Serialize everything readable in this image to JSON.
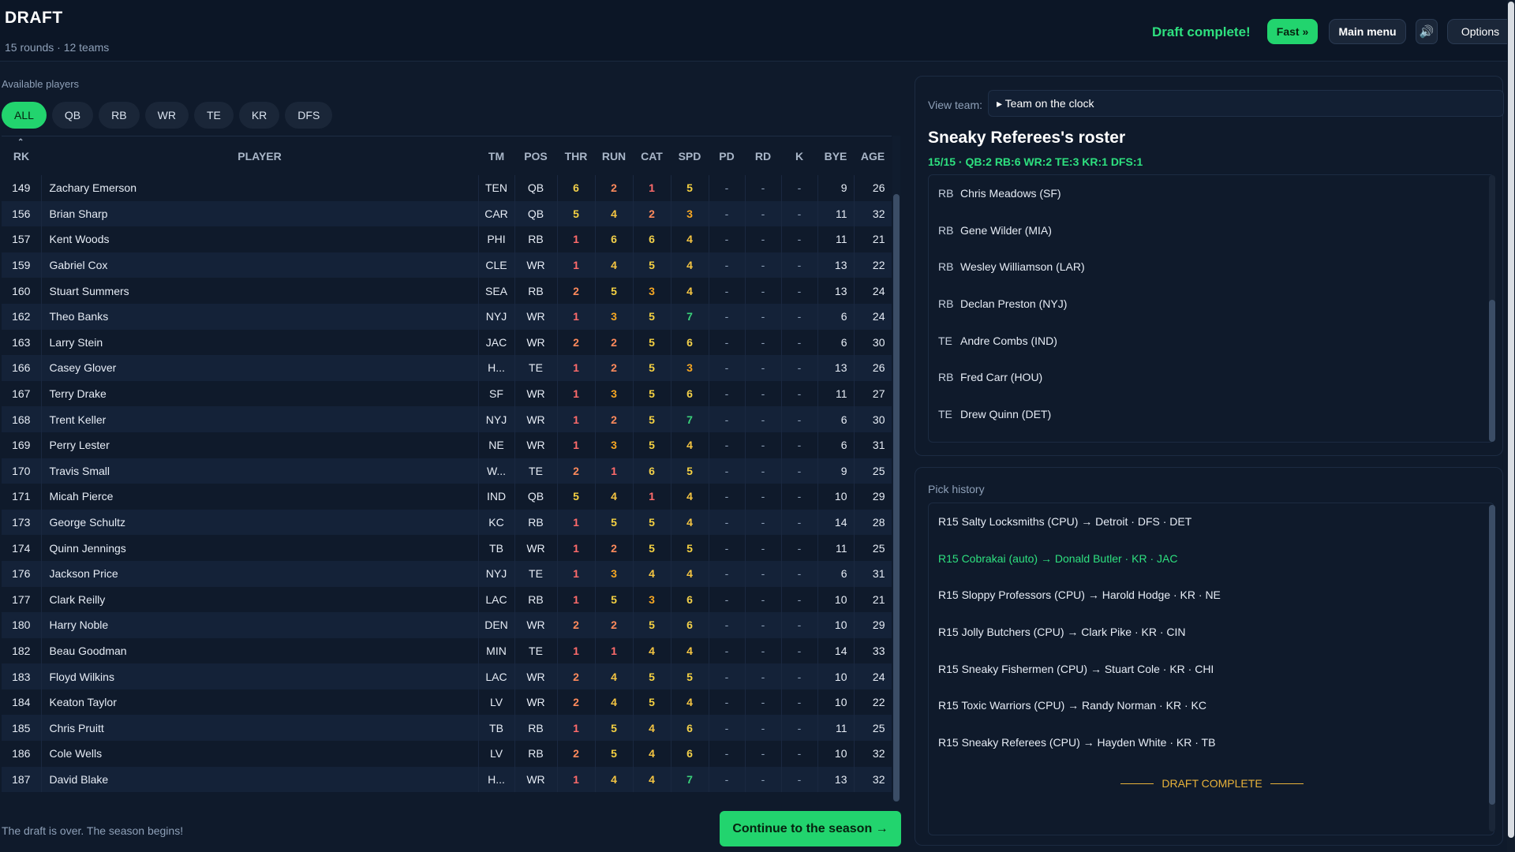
{
  "header": {
    "title": "DRAFT",
    "subtitle": "15 rounds · 12 teams",
    "status": "Draft complete!",
    "fast_label": "Fast »",
    "main_menu_label": "Main menu",
    "sound_icon": "🔊",
    "options_label": "Options"
  },
  "players": {
    "label": "Available players",
    "filters": [
      "ALL",
      "QB",
      "RB",
      "WR",
      "TE",
      "KR",
      "DFS"
    ],
    "active_filter": "ALL",
    "sort_caret": "⌃",
    "columns": [
      "RK",
      "PLAYER",
      "TM",
      "POS",
      "THR",
      "RUN",
      "CAT",
      "SPD",
      "PD",
      "RD",
      "K",
      "BYE",
      "AGE"
    ],
    "rows": [
      {
        "rk": "149",
        "name": "Zachary Emerson",
        "tm": "TEN",
        "pos": "QB",
        "thr": "6",
        "run": "2",
        "cat": "1",
        "spd": "5",
        "pd": "-",
        "rd": "-",
        "k": "-",
        "bye": "9",
        "age": "26"
      },
      {
        "rk": "156",
        "name": "Brian Sharp",
        "tm": "CAR",
        "pos": "QB",
        "thr": "5",
        "run": "4",
        "cat": "2",
        "spd": "3",
        "pd": "-",
        "rd": "-",
        "k": "-",
        "bye": "11",
        "age": "32"
      },
      {
        "rk": "157",
        "name": "Kent Woods",
        "tm": "PHI",
        "pos": "RB",
        "thr": "1",
        "run": "6",
        "cat": "6",
        "spd": "4",
        "pd": "-",
        "rd": "-",
        "k": "-",
        "bye": "11",
        "age": "21"
      },
      {
        "rk": "159",
        "name": "Gabriel Cox",
        "tm": "CLE",
        "pos": "WR",
        "thr": "1",
        "run": "4",
        "cat": "5",
        "spd": "4",
        "pd": "-",
        "rd": "-",
        "k": "-",
        "bye": "13",
        "age": "22"
      },
      {
        "rk": "160",
        "name": "Stuart Summers",
        "tm": "SEA",
        "pos": "RB",
        "thr": "2",
        "run": "5",
        "cat": "3",
        "spd": "4",
        "pd": "-",
        "rd": "-",
        "k": "-",
        "bye": "13",
        "age": "24"
      },
      {
        "rk": "162",
        "name": "Theo Banks",
        "tm": "NYJ",
        "pos": "WR",
        "thr": "1",
        "run": "3",
        "cat": "5",
        "spd": "7",
        "pd": "-",
        "rd": "-",
        "k": "-",
        "bye": "6",
        "age": "24"
      },
      {
        "rk": "163",
        "name": "Larry Stein",
        "tm": "JAC",
        "pos": "WR",
        "thr": "2",
        "run": "2",
        "cat": "5",
        "spd": "6",
        "pd": "-",
        "rd": "-",
        "k": "-",
        "bye": "6",
        "age": "30"
      },
      {
        "rk": "166",
        "name": "Casey Glover",
        "tm": "H...",
        "pos": "TE",
        "thr": "1",
        "run": "2",
        "cat": "5",
        "spd": "3",
        "pd": "-",
        "rd": "-",
        "k": "-",
        "bye": "13",
        "age": "26"
      },
      {
        "rk": "167",
        "name": "Terry Drake",
        "tm": "SF",
        "pos": "WR",
        "thr": "1",
        "run": "3",
        "cat": "5",
        "spd": "6",
        "pd": "-",
        "rd": "-",
        "k": "-",
        "bye": "11",
        "age": "27"
      },
      {
        "rk": "168",
        "name": "Trent Keller",
        "tm": "NYJ",
        "pos": "WR",
        "thr": "1",
        "run": "2",
        "cat": "5",
        "spd": "7",
        "pd": "-",
        "rd": "-",
        "k": "-",
        "bye": "6",
        "age": "30"
      },
      {
        "rk": "169",
        "name": "Perry Lester",
        "tm": "NE",
        "pos": "WR",
        "thr": "1",
        "run": "3",
        "cat": "5",
        "spd": "4",
        "pd": "-",
        "rd": "-",
        "k": "-",
        "bye": "6",
        "age": "31"
      },
      {
        "rk": "170",
        "name": "Travis Small",
        "tm": "W...",
        "pos": "TE",
        "thr": "2",
        "run": "1",
        "cat": "6",
        "spd": "5",
        "pd": "-",
        "rd": "-",
        "k": "-",
        "bye": "9",
        "age": "25"
      },
      {
        "rk": "171",
        "name": "Micah Pierce",
        "tm": "IND",
        "pos": "QB",
        "thr": "5",
        "run": "4",
        "cat": "1",
        "spd": "4",
        "pd": "-",
        "rd": "-",
        "k": "-",
        "bye": "10",
        "age": "29"
      },
      {
        "rk": "173",
        "name": "George Schultz",
        "tm": "KC",
        "pos": "RB",
        "thr": "1",
        "run": "5",
        "cat": "5",
        "spd": "4",
        "pd": "-",
        "rd": "-",
        "k": "-",
        "bye": "14",
        "age": "28"
      },
      {
        "rk": "174",
        "name": "Quinn Jennings",
        "tm": "TB",
        "pos": "WR",
        "thr": "1",
        "run": "2",
        "cat": "5",
        "spd": "5",
        "pd": "-",
        "rd": "-",
        "k": "-",
        "bye": "11",
        "age": "25"
      },
      {
        "rk": "176",
        "name": "Jackson Price",
        "tm": "NYJ",
        "pos": "TE",
        "thr": "1",
        "run": "3",
        "cat": "4",
        "spd": "4",
        "pd": "-",
        "rd": "-",
        "k": "-",
        "bye": "6",
        "age": "31"
      },
      {
        "rk": "177",
        "name": "Clark Reilly",
        "tm": "LAC",
        "pos": "RB",
        "thr": "1",
        "run": "5",
        "cat": "3",
        "spd": "6",
        "pd": "-",
        "rd": "-",
        "k": "-",
        "bye": "10",
        "age": "21"
      },
      {
        "rk": "180",
        "name": "Harry Noble",
        "tm": "DEN",
        "pos": "WR",
        "thr": "2",
        "run": "2",
        "cat": "5",
        "spd": "6",
        "pd": "-",
        "rd": "-",
        "k": "-",
        "bye": "10",
        "age": "29"
      },
      {
        "rk": "182",
        "name": "Beau Goodman",
        "tm": "MIN",
        "pos": "TE",
        "thr": "1",
        "run": "1",
        "cat": "4",
        "spd": "4",
        "pd": "-",
        "rd": "-",
        "k": "-",
        "bye": "14",
        "age": "33"
      },
      {
        "rk": "183",
        "name": "Floyd Wilkins",
        "tm": "LAC",
        "pos": "WR",
        "thr": "2",
        "run": "4",
        "cat": "5",
        "spd": "5",
        "pd": "-",
        "rd": "-",
        "k": "-",
        "bye": "10",
        "age": "24"
      },
      {
        "rk": "184",
        "name": "Keaton Taylor",
        "tm": "LV",
        "pos": "WR",
        "thr": "2",
        "run": "4",
        "cat": "5",
        "spd": "4",
        "pd": "-",
        "rd": "-",
        "k": "-",
        "bye": "10",
        "age": "22"
      },
      {
        "rk": "185",
        "name": "Chris Pruitt",
        "tm": "TB",
        "pos": "RB",
        "thr": "1",
        "run": "5",
        "cat": "4",
        "spd": "6",
        "pd": "-",
        "rd": "-",
        "k": "-",
        "bye": "11",
        "age": "25"
      },
      {
        "rk": "186",
        "name": "Cole Wells",
        "tm": "LV",
        "pos": "RB",
        "thr": "2",
        "run": "5",
        "cat": "4",
        "spd": "6",
        "pd": "-",
        "rd": "-",
        "k": "-",
        "bye": "10",
        "age": "32"
      },
      {
        "rk": "187",
        "name": "David Blake",
        "tm": "H...",
        "pos": "WR",
        "thr": "1",
        "run": "4",
        "cat": "4",
        "spd": "7",
        "pd": "-",
        "rd": "-",
        "k": "-",
        "bye": "13",
        "age": "32"
      }
    ]
  },
  "stat_colors": {
    "1": "#ff6b6b",
    "2": "#ff8a5c",
    "3": "#f5a623",
    "4": "#f5c542",
    "5": "#f5d142",
    "6": "#f2d04a",
    "7": "#3ad17a"
  },
  "footer": {
    "message": "The draft is over. The season begins!",
    "continue_label": "Continue to the season →"
  },
  "roster": {
    "view_label": "View team:",
    "view_value": "▸ Team on the clock",
    "title": "Sneaky Referees's roster",
    "summary": "15/15  ·  QB:2 RB:6 WR:2 TE:3 KR:1 DFS:1",
    "items": [
      {
        "pos": "RB",
        "text": "Chris Meadows  (SF)"
      },
      {
        "pos": "RB",
        "text": "Gene Wilder  (MIA)"
      },
      {
        "pos": "RB",
        "text": "Wesley Williamson  (LAR)"
      },
      {
        "pos": "RB",
        "text": "Declan Preston  (NYJ)"
      },
      {
        "pos": "TE",
        "text": "Andre Combs  (IND)"
      },
      {
        "pos": "RB",
        "text": "Fred Carr  (HOU)"
      },
      {
        "pos": "TE",
        "text": "Drew Quinn  (DET)"
      }
    ]
  },
  "history": {
    "label": "Pick history",
    "items": [
      {
        "text": "R15  Salty Locksmiths (CPU)  →  Detroit · DFS · DET",
        "highlight": false
      },
      {
        "text": "R15  Cobrakai (auto)  →  Donald Butler · KR · JAC",
        "highlight": true
      },
      {
        "text": "R15  Sloppy Professors (CPU)  →  Harold Hodge · KR · NE",
        "highlight": false
      },
      {
        "text": "R15  Jolly Butchers (CPU)  →  Clark Pike · KR · CIN",
        "highlight": false
      },
      {
        "text": "R15  Sneaky Fishermen (CPU)  →  Stuart Cole · KR · CHI",
        "highlight": false
      },
      {
        "text": "R15  Toxic Warriors (CPU)  →  Randy Norman · KR · KC",
        "highlight": false
      },
      {
        "text": "R15  Sneaky Referees (CPU)  →  Hayden White · KR · TB",
        "highlight": false
      }
    ],
    "complete_label": "DRAFT COMPLETE"
  }
}
